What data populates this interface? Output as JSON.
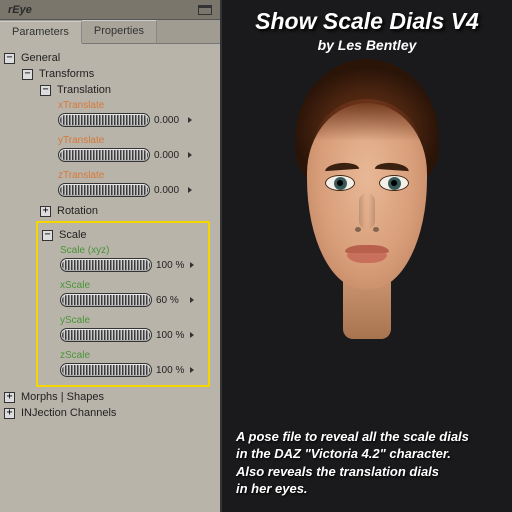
{
  "window": {
    "title": "rEye"
  },
  "tabs": {
    "parameters": "Parameters",
    "properties": "Properties"
  },
  "tree": {
    "general": "General",
    "transforms": "Transforms",
    "translation": "Translation",
    "rotation": "Rotation",
    "scale": "Scale",
    "morphs": "Morphs | Shapes",
    "injection": "INJection Channels"
  },
  "dials": {
    "xt": {
      "label": "xTranslate",
      "value": "0.000"
    },
    "yt": {
      "label": "yTranslate",
      "value": "0.000"
    },
    "zt": {
      "label": "zTranslate",
      "value": "0.000"
    },
    "sxyz": {
      "label": "Scale (xyz)",
      "value": "100 %"
    },
    "xs": {
      "label": "xScale",
      "value": "60 %"
    },
    "ys": {
      "label": "yScale",
      "value": "100 %"
    },
    "zs": {
      "label": "zScale",
      "value": "100 %"
    }
  },
  "promo": {
    "title": "Show Scale Dials V4",
    "byline": "by Les Bentley",
    "desc1": "A pose file to reveal all the scale dials",
    "desc2": "in the DAZ \"Victoria 4.2\" character.",
    "desc3": "Also reveals the translation dials",
    "desc4": "in her eyes."
  }
}
